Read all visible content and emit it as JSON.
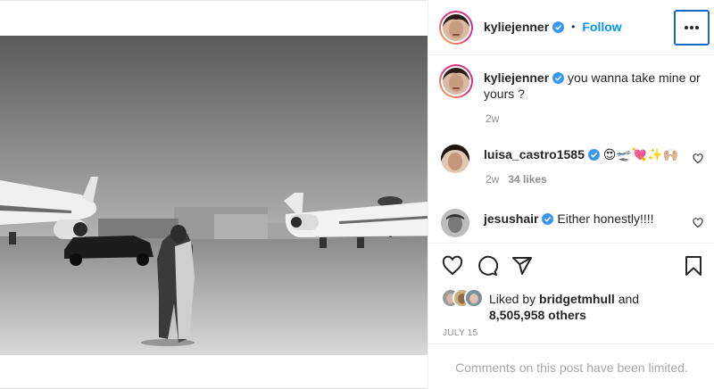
{
  "post": {
    "username": "kyliejenner",
    "follow_label": "Follow",
    "separator": "•",
    "more_label": "More options"
  },
  "caption": {
    "username": "kyliejenner",
    "text": "you wanna take mine or yours ?",
    "time": "2w"
  },
  "comments": [
    {
      "username": "luisa_castro1585",
      "text": "😍🛫💘✨🙌🏼",
      "time": "2w",
      "likes": "34 likes"
    },
    {
      "username": "jesushair",
      "text": "Either honestly!!!!"
    }
  ],
  "likes": {
    "prefix": "Liked by",
    "user": "bridgetmhull",
    "connector": "and",
    "others": "8,505,958 others"
  },
  "date": "JULY 15",
  "comments_limited": "Comments on this post have been limited.",
  "colors": {
    "accent": "#0095f6",
    "verified": "#3897f0",
    "muted": "#8e8e8e",
    "focus_border": "#1a66c8"
  },
  "icons": {
    "verified": "verified-badge-icon",
    "more": "ellipsis-icon",
    "like": "heart-outline-icon",
    "comment": "comment-bubble-icon",
    "share": "paper-plane-icon",
    "save": "bookmark-icon"
  }
}
